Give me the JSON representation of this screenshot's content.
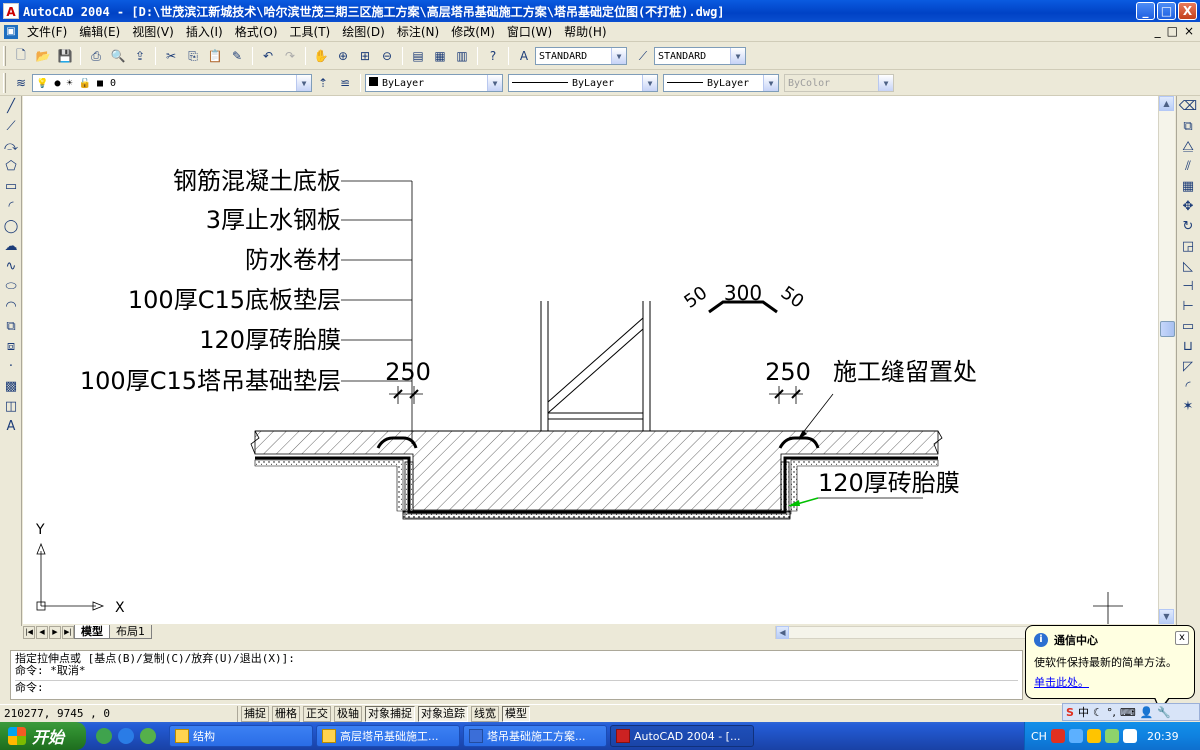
{
  "window": {
    "title": "AutoCAD 2004 - [D:\\世茂滨江新城技术\\哈尔滨世茂三期三区施工方案\\高层塔吊基础施工方案\\塔吊基础定位图(不打桩).dwg]",
    "app_icon": "A",
    "minimize": "_",
    "maximize": "□",
    "close": "X"
  },
  "menu": {
    "items": [
      "文件(F)",
      "编辑(E)",
      "视图(V)",
      "插入(I)",
      "格式(O)",
      "工具(T)",
      "绘图(D)",
      "标注(N)",
      "修改(M)",
      "窗口(W)",
      "帮助(H)"
    ],
    "mdi_minimize": "_",
    "mdi_restore": "□",
    "mdi_close": "×"
  },
  "toolbar": {
    "text_style": "STANDARD",
    "dim_style": "STANDARD",
    "layer": "0",
    "color": "ByLayer",
    "linetype": "ByLayer",
    "lineweight": "ByLayer",
    "plotstyle": "ByColor"
  },
  "drawing": {
    "labels": [
      "钢筋混凝土底板",
      "3厚止水钢板",
      "防水卷材",
      "100厚C15底板垫层",
      "120厚砖胎膜",
      "100厚C15塔吊基础垫层"
    ],
    "dim_left": "250",
    "dim_right": "250",
    "joint_label": "施工缝留置处",
    "brick_label": "120厚砖胎膜",
    "waterstop_dim_center": "300",
    "waterstop_dim_left": "50",
    "waterstop_dim_right": "50",
    "ucs_x": "X",
    "ucs_y": "Y"
  },
  "tabs": {
    "model": "模型",
    "layout1": "布局1"
  },
  "command": {
    "line1": "指定拉伸点或 [基点(B)/复制(C)/放弃(U)/退出(X)]:",
    "line2": "命令: *取消*",
    "prompt": "命令:"
  },
  "status": {
    "coords": "210277, 9745 , 0",
    "buttons": [
      {
        "label": "捕捉",
        "on": false
      },
      {
        "label": "栅格",
        "on": false
      },
      {
        "label": "正交",
        "on": false
      },
      {
        "label": "极轴",
        "on": false
      },
      {
        "label": "对象捕捉",
        "on": true
      },
      {
        "label": "对象追踪",
        "on": true
      },
      {
        "label": "线宽",
        "on": false
      },
      {
        "label": "模型",
        "on": true
      }
    ]
  },
  "balloon": {
    "title": "通信中心",
    "message": "使软件保持最新的简单方法。",
    "link": "单击此处。",
    "close": "x"
  },
  "taskbar": {
    "start": "开始",
    "tasks": [
      "结构",
      "高层塔吊基础施工...",
      "塔吊基础施工方案...",
      "AutoCAD 2004 - [..."
    ],
    "time": "20:39",
    "lang": "CH"
  },
  "ime": {
    "label": "中"
  },
  "colors": {
    "titlebar": "#0a5be0",
    "leader_green": "#00c000",
    "link": "#0000ff"
  }
}
